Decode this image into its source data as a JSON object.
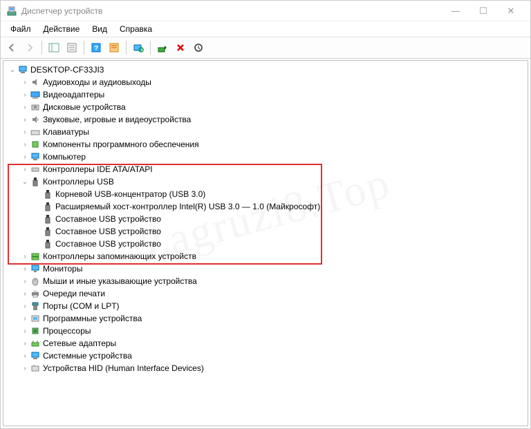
{
  "window": {
    "title": "Диспетчер устройств"
  },
  "menu": {
    "file": "Файл",
    "action": "Действие",
    "view": "Вид",
    "help": "Справка"
  },
  "tree": {
    "root": "DESKTOP-CF33JI3",
    "audio": "Аудиовходы и аудиовыходы",
    "video_adapters": "Видеоадаптеры",
    "disk_drives": "Дисковые устройства",
    "sound_game": "Звуковые, игровые и видеоустройства",
    "keyboards": "Клавиатуры",
    "software_components": "Компоненты программного обеспечения",
    "computer": "Компьютер",
    "ide_ata": "Контроллеры IDE ATA/ATAPI",
    "usb_controllers": "Контроллеры USB",
    "usb_root_hub": "Корневой USB-концентратор (USB 3.0)",
    "usb_host_intel": "Расширяемый хост-контроллер Intel(R) USB 3.0 — 1.0 (Майкрософт)",
    "usb_composite1": "Составное USB устройство",
    "usb_composite2": "Составное USB устройство",
    "usb_composite3": "Составное USB устройство",
    "storage_controllers": "Контроллеры запоминающих устройств",
    "monitors": "Мониторы",
    "mice": "Мыши и иные указывающие устройства",
    "print_queues": "Очереди печати",
    "ports": "Порты (COM и LPT)",
    "software_devices": "Программные устройства",
    "processors": "Процессоры",
    "network": "Сетевые адаптеры",
    "system_devices": "Системные устройства",
    "hid": "Устройства HID (Human Interface Devices)"
  }
}
